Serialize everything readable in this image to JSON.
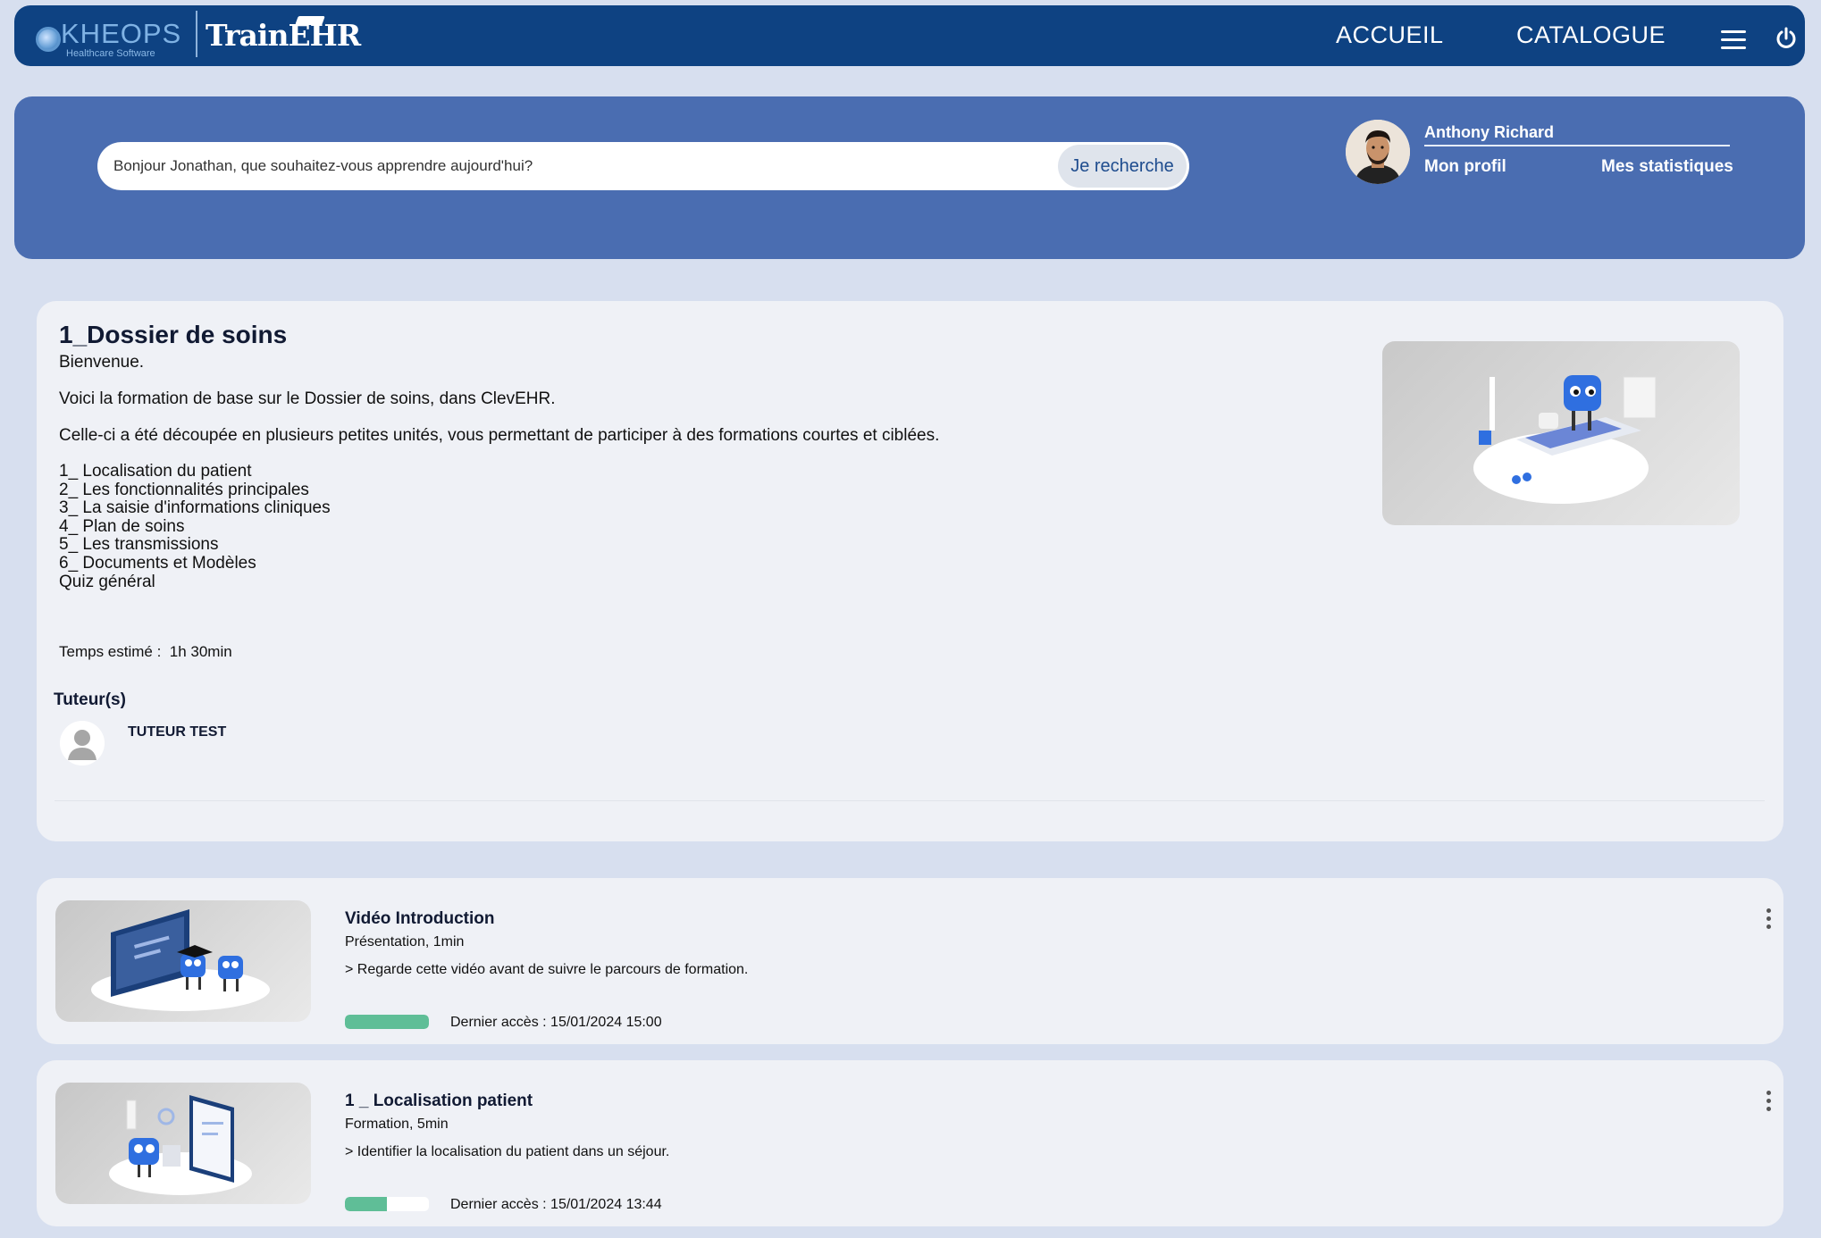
{
  "brand": {
    "kheops": "KHEOPS",
    "kheops_sub": "Healthcare Software",
    "app": "TrainEHR"
  },
  "nav": {
    "accueil": "ACCUEIL",
    "catalogue": "CATALOGUE"
  },
  "search": {
    "placeholder": "Bonjour Jonathan, que souhaitez-vous apprendre aujourd'hui?",
    "button": "Je recherche"
  },
  "user": {
    "name": "Anthony Richard",
    "profile": "Mon profil",
    "stats": "Mes statistiques"
  },
  "course": {
    "title": "1_Dossier de soins",
    "welcome": "Bienvenue.",
    "intro": "Voici la formation de base sur le Dossier de soins, dans ClevEHR.",
    "description": "Celle-ci a été découpée en plusieurs petites unités, vous permettant de participer à des formations courtes et ciblées.",
    "units": [
      "1_ Localisation du patient",
      "2_ Les fonctionnalités principales",
      "3_ La saisie d'informations cliniques",
      "4_ Plan de soins",
      "5_ Les transmissions",
      "6_ Documents et Modèles",
      "Quiz général"
    ],
    "time_label": "Temps estimé :",
    "time_value": "1h 30min",
    "tutors_title": "Tuteur(s)",
    "tutor_name": "TUTEUR TEST"
  },
  "modules": [
    {
      "title": "Vidéo Introduction",
      "meta": "Présentation, 1min",
      "description": "> Regarde cette vidéo avant de suivre le parcours de formation.",
      "progress": 1.0,
      "last_access": "Dernier accès : 15/01/2024 15:00"
    },
    {
      "title": "1 _ Localisation patient",
      "meta": "Formation, 5min",
      "description": "> Identifier la localisation du patient dans un séjour.",
      "progress": 0.5,
      "last_access": "Dernier accès : 15/01/2024 13:44"
    }
  ],
  "colors": {
    "topbar": "#0e4282",
    "banner": "#4a6db1",
    "background": "#d7dfef",
    "progress": "#5fbe97",
    "mascot": "#2f6fe0"
  }
}
